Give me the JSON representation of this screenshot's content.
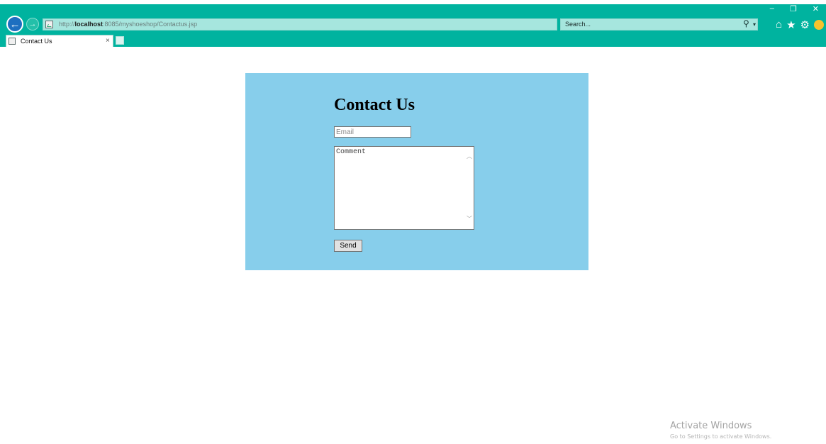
{
  "browser": {
    "url_prefix": "http://",
    "url_host": "localhost",
    "url_rest": ":8085/myshoeshop/Contactus.jsp",
    "search_placeholder": "Search...",
    "tab_title": "Contact Us",
    "tab_close": "×",
    "window_controls": {
      "minimize": "–",
      "restore": "❐",
      "close": "✕"
    },
    "icons": [
      "back-arrow-icon",
      "forward-arrow-icon",
      "page-icon",
      "refresh-icon",
      "search-icon",
      "home-icon",
      "star-icon",
      "gear-icon",
      "smiley-icon"
    ]
  },
  "form": {
    "heading": "Contact Us",
    "email_placeholder": "Email",
    "comment_placeholder": "Comment",
    "send_label": "Send",
    "panel_color": "#87ceeb"
  },
  "watermark": {
    "title": "Activate Windows",
    "subtitle": "Go to Settings to activate Windows."
  },
  "colors": {
    "chrome": "#00b39f",
    "address_bar": "#a6e6de"
  }
}
